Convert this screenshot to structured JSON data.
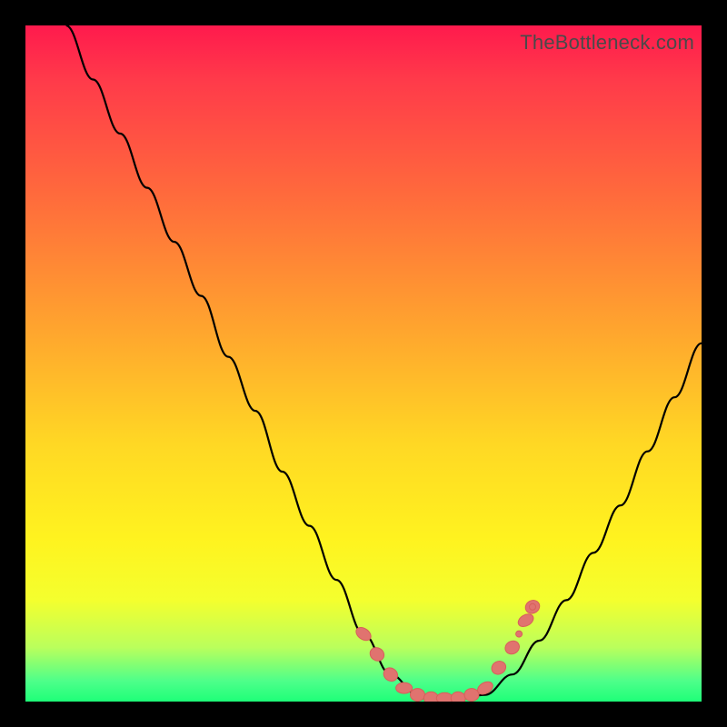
{
  "watermark": "TheBottleneck.com",
  "colors": {
    "frame": "#000000",
    "curve": "#000000",
    "marker": "#e0736f",
    "gradient_top": "#ff1a4d",
    "gradient_bottom": "#1eff78"
  },
  "chart_data": {
    "type": "line",
    "title": "",
    "xlabel": "",
    "ylabel": "",
    "xlim": [
      0,
      100
    ],
    "ylim": [
      0,
      100
    ],
    "x": [
      6,
      10,
      14,
      18,
      22,
      26,
      30,
      34,
      38,
      42,
      46,
      50,
      54,
      58,
      60,
      64,
      68,
      72,
      76,
      80,
      84,
      88,
      92,
      96,
      100
    ],
    "y": [
      100,
      92,
      84,
      76,
      68,
      60,
      51,
      43,
      34,
      26,
      18,
      10,
      4,
      1,
      0.5,
      0.5,
      1,
      4,
      9,
      15,
      22,
      29,
      37,
      45,
      53
    ],
    "series": [
      {
        "name": "bottleneck-curve",
        "x": [
          6,
          10,
          14,
          18,
          22,
          26,
          30,
          34,
          38,
          42,
          46,
          50,
          54,
          58,
          60,
          64,
          68,
          72,
          76,
          80,
          84,
          88,
          92,
          96,
          100
        ],
        "y": [
          100,
          92,
          84,
          76,
          68,
          60,
          51,
          43,
          34,
          26,
          18,
          10,
          4,
          1,
          0.5,
          0.5,
          1,
          4,
          9,
          15,
          22,
          29,
          37,
          45,
          53
        ]
      }
    ],
    "annotations": {
      "highlighted_points": [
        {
          "x": 50,
          "y": 10
        },
        {
          "x": 52,
          "y": 7
        },
        {
          "x": 54,
          "y": 4
        },
        {
          "x": 56,
          "y": 2
        },
        {
          "x": 58,
          "y": 1
        },
        {
          "x": 60,
          "y": 0.5
        },
        {
          "x": 62,
          "y": 0.5
        },
        {
          "x": 64,
          "y": 0.5
        },
        {
          "x": 66,
          "y": 1
        },
        {
          "x": 68,
          "y": 2
        },
        {
          "x": 70,
          "y": 5
        },
        {
          "x": 72,
          "y": 8
        },
        {
          "x": 74,
          "y": 12
        },
        {
          "x": 75,
          "y": 14
        }
      ]
    }
  }
}
